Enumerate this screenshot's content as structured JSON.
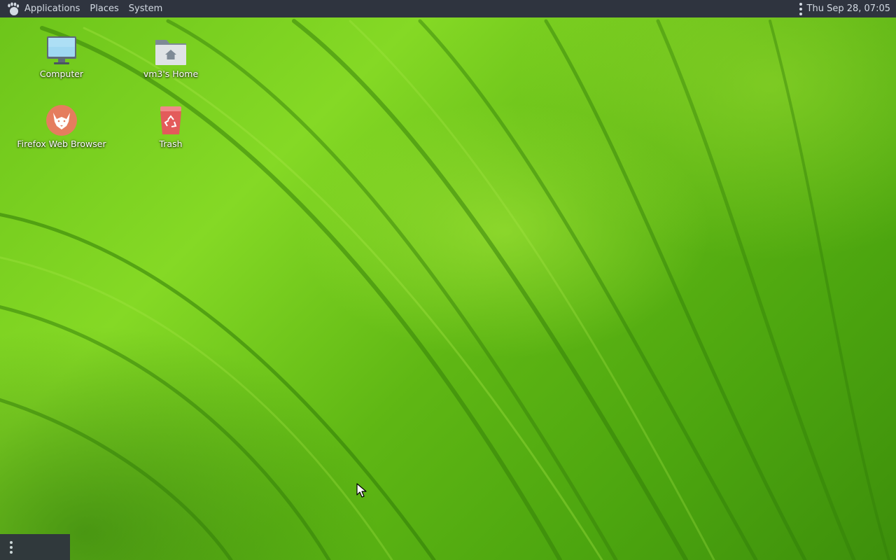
{
  "top_panel": {
    "menus": [
      {
        "label": "Applications"
      },
      {
        "label": "Places"
      },
      {
        "label": "System"
      }
    ],
    "clock": "Thu Sep 28, 07:05",
    "background_color": "#2f343f",
    "text_color": "#d3dae3"
  },
  "desktop_icons": [
    {
      "label": "Computer",
      "icon": "computer-icon"
    },
    {
      "label": "vm3's Home",
      "icon": "home-folder-icon"
    },
    {
      "label": "Firefox Web Browser",
      "icon": "firefox-icon"
    },
    {
      "label": "Trash",
      "icon": "trash-icon"
    }
  ],
  "wallpaper": {
    "accent": "#7ccf1f"
  }
}
